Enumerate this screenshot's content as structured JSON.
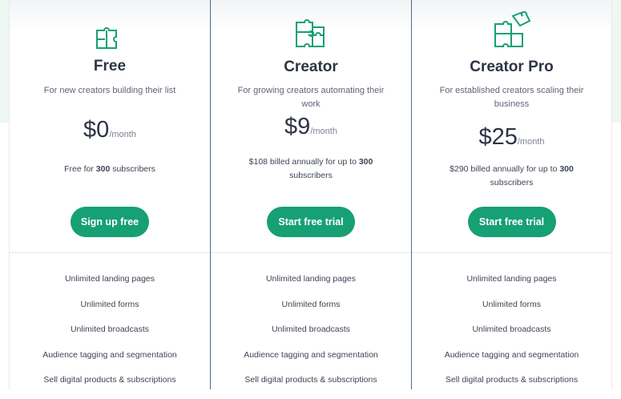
{
  "colors": {
    "accent": "#16a074",
    "heading": "#2d3445",
    "band": "#eef7f2",
    "divider_blue": "#4e6a92"
  },
  "plans": [
    {
      "icon": "puzzle-piece-icon",
      "name": "Free",
      "description": "For new creators building their list",
      "price": "$0",
      "per": "/month",
      "billing_pre": "Free for ",
      "billing_bold": "300",
      "billing_post": " subscribers",
      "cta": "Sign up free",
      "features": [
        "Unlimited landing pages",
        "Unlimited forms",
        "Unlimited broadcasts",
        "Audience tagging and segmentation",
        "Sell digital products & subscriptions"
      ]
    },
    {
      "icon": "puzzle-pieces-icon",
      "name": "Creator",
      "description": "For growing creators automating their work",
      "price": "$9",
      "per": "/month",
      "billing_pre": "$108 billed annually for up to ",
      "billing_bold": "300",
      "billing_post": " subscribers",
      "cta": "Start free trial",
      "features": [
        "Unlimited landing pages",
        "Unlimited forms",
        "Unlimited broadcasts",
        "Audience tagging and segmentation",
        "Sell digital products & subscriptions"
      ]
    },
    {
      "icon": "puzzle-stack-icon",
      "name": "Creator Pro",
      "description": "For established creators scaling their business",
      "price": "$25",
      "per": "/month",
      "billing_pre": "$290 billed annually for up to ",
      "billing_bold": "300",
      "billing_post": " subscribers",
      "cta": "Start free trial",
      "features": [
        "Unlimited landing pages",
        "Unlimited forms",
        "Unlimited broadcasts",
        "Audience tagging and segmentation",
        "Sell digital products & subscriptions"
      ]
    }
  ]
}
